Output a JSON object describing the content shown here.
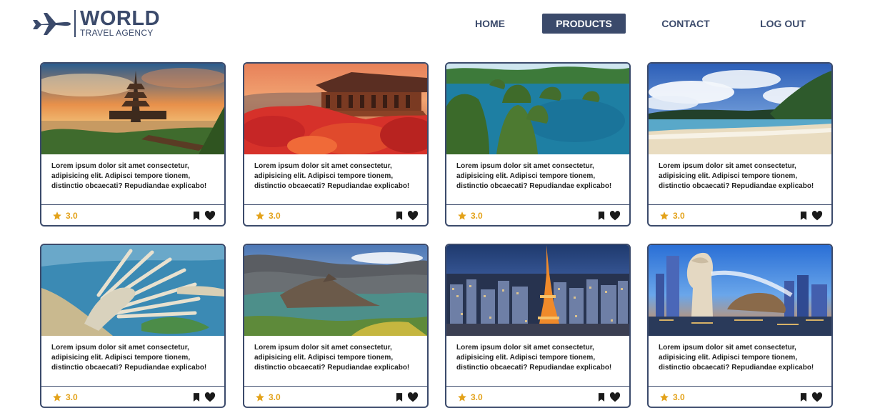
{
  "brand": {
    "name": "WORLD",
    "subtitle": "TRAVEL AGENCY"
  },
  "nav": {
    "items": [
      {
        "label": "HOME",
        "active": false
      },
      {
        "label": "PRODUCTS",
        "active": true
      },
      {
        "label": "CONTACT",
        "active": false
      },
      {
        "label": "LOG OUT",
        "active": false
      }
    ]
  },
  "colors": {
    "brand": "#3b4a6b",
    "star": "#e3a21a",
    "border": "#3b4a6b"
  },
  "cards": [
    {
      "scene": "temple-lake-sunset",
      "description": "Lorem ipsum dolor sit amet consectetur, adipisicing elit. Adipisci tempore tionem, distinctio obcaecati? Repudiandae explicabo!",
      "rating": "3.0"
    },
    {
      "scene": "japanese-temple-autumn",
      "description": "Lorem ipsum dolor sit amet consectetur, adipisicing elit. Adipisci tempore tionem, distinctio obcaecati? Repudiandae explicabo!",
      "rating": "3.0"
    },
    {
      "scene": "lagoon-islands",
      "description": "Lorem ipsum dolor sit amet consectetur, adipisicing elit. Adipisci tempore tionem, distinctio obcaecati? Repudiandae explicabo!",
      "rating": "3.0"
    },
    {
      "scene": "tropical-beach",
      "description": "Lorem ipsum dolor sit amet consectetur, adipisicing elit. Adipisci tempore tionem, distinctio obcaecati? Repudiandae explicabo!",
      "rating": "3.0"
    },
    {
      "scene": "palm-island-aerial",
      "description": "Lorem ipsum dolor sit amet consectetur, adipisicing elit. Adipisci tempore tionem, distinctio obcaecati? Repudiandae explicabo!",
      "rating": "3.0"
    },
    {
      "scene": "volcano-crater-lake",
      "description": "Lorem ipsum dolor sit amet consectetur, adipisicing elit. Adipisci tempore tionem, distinctio obcaecati? Repudiandae explicabo!",
      "rating": "3.0"
    },
    {
      "scene": "tokyo-tower-night",
      "description": "Lorem ipsum dolor sit amet consectetur, adipisicing elit. Adipisci tempore tionem, distinctio obcaecati? Repudiandae explicabo!",
      "rating": "3.0"
    },
    {
      "scene": "merlion-singapore",
      "description": "Lorem ipsum dolor sit amet consectetur, adipisicing elit. Adipisci tempore tionem, distinctio obcaecati? Repudiandae explicabo!",
      "rating": "3.0"
    }
  ],
  "icons": {
    "rating": "star-icon",
    "save": "bookmark-icon",
    "like": "heart-icon",
    "logo": "airplane-icon"
  }
}
